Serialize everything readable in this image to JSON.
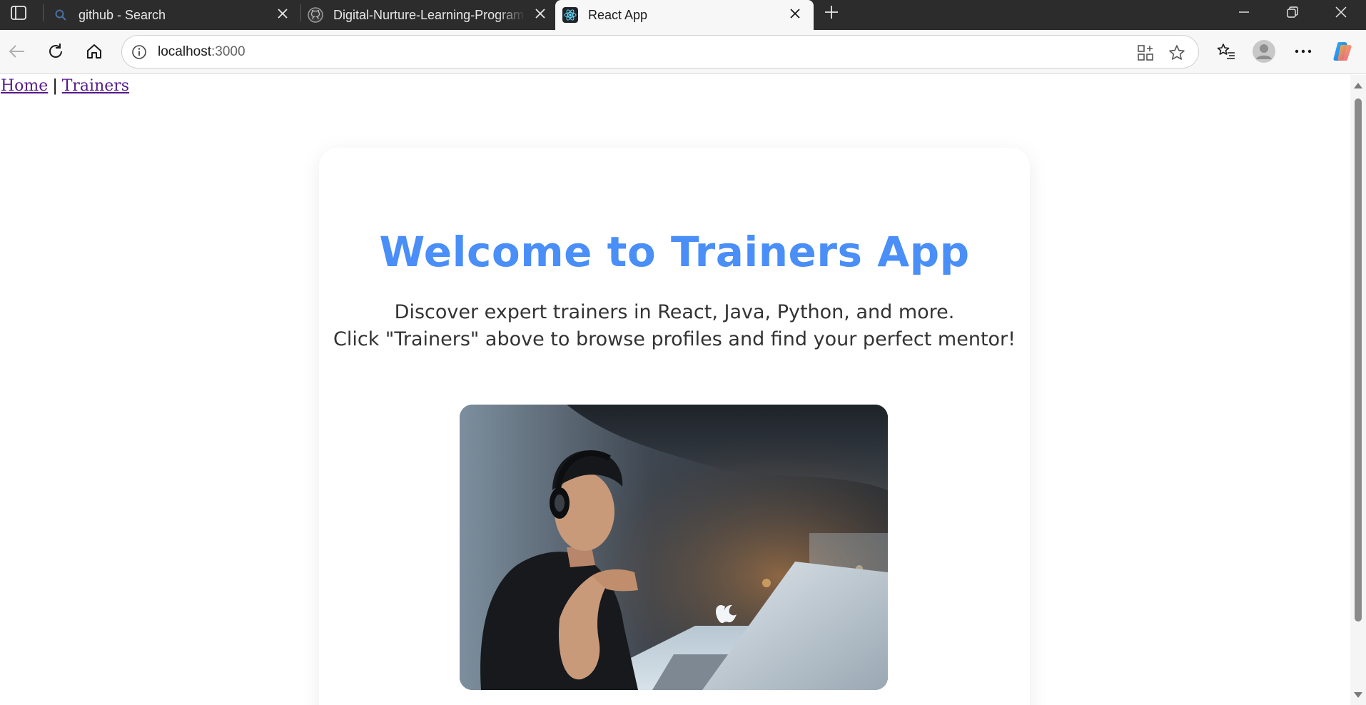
{
  "browser": {
    "tabs": [
      {
        "title": "github - Search",
        "icon": "search-icon"
      },
      {
        "title": "Digital-Nurture-Learning-Program",
        "icon": "github-icon"
      },
      {
        "title": "React App",
        "icon": "react-icon",
        "active": true
      }
    ],
    "address": {
      "host": "localhost",
      "port": ":3000"
    },
    "colors": {
      "tabstrip": "#2c2c2c",
      "toolbar": "#f7f7f7",
      "link_visited": "#551a8b"
    }
  },
  "nav": {
    "home": "Home",
    "separator": "|",
    "trainers": "Trainers"
  },
  "hero": {
    "title": "Welcome to Trainers App",
    "line1": "Discover expert trainers in React, Java, Python, and more.",
    "line2": "Click \"Trainers\" above to browse profiles and find your perfect mentor!",
    "title_color": "#4a8ef7"
  }
}
